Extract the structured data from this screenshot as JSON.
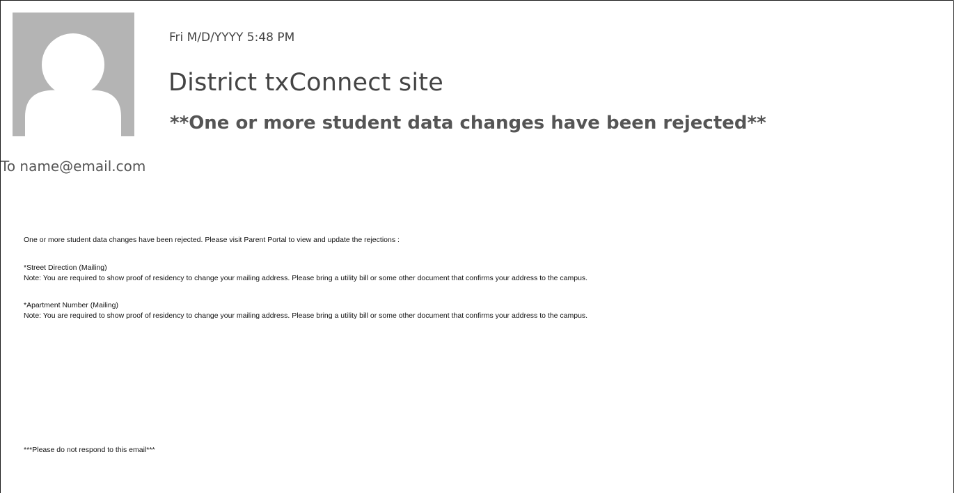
{
  "email": {
    "datetime": "Fri M/D/YYYY 5:48 PM",
    "sender": "District txConnect site",
    "subject": "**One or more student data changes have been rejected**",
    "recipient": "To name@email.com",
    "avatar_icon": "person-placeholder-icon",
    "body": {
      "intro": "One or more student data changes have been rejected. Please visit Parent Portal to view and update the rejections :",
      "items": [
        {
          "title": "*Street Direction (Mailing)",
          "note": "Note:  You are required to show proof of residency to change your mailing address. Please bring a utility bill or some other document that confirms your address to the campus."
        },
        {
          "title": "*Apartment Number (Mailing)",
          "note": "Note:  You are required to show proof of residency to change your mailing address. Please bring a utility bill or some other document that confirms your address to the campus."
        }
      ],
      "footer": "***Please do not respond to this email***"
    }
  },
  "colors": {
    "avatar_bg": "#b4b4b4",
    "avatar_fg": "#ffffff",
    "header_text": "#444444",
    "body_text": "#111111"
  }
}
